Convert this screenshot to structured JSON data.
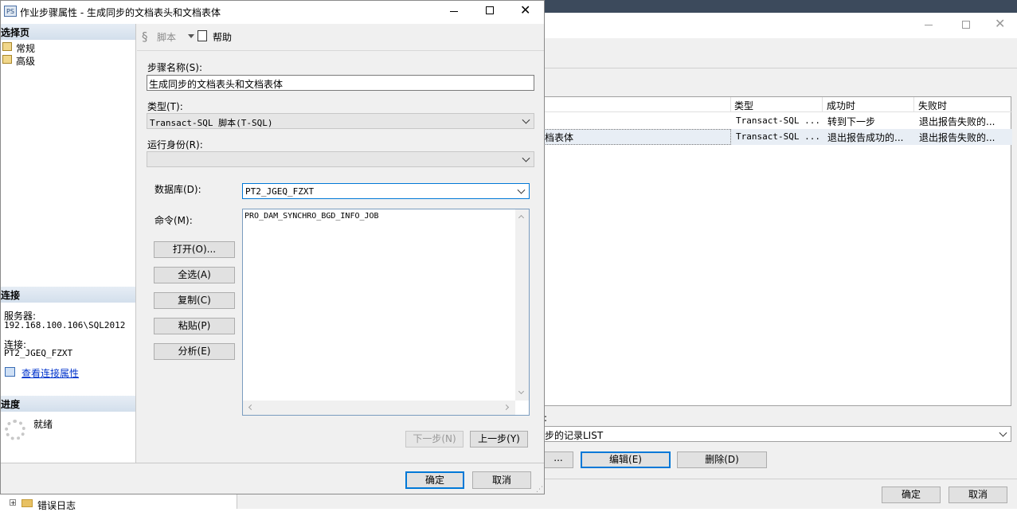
{
  "bg_window": {
    "grid_headers": [
      "类型",
      "成功时",
      "失败时"
    ],
    "rows": [
      {
        "step": "",
        "type": "Transact-SQL ...",
        "success": "转到下一步",
        "failure": "退出报告失败的..."
      },
      {
        "step": "档表体",
        "type": "Transact-SQL ...",
        "success": "退出报告成功的...",
        "failure": "退出报告失败的..."
      }
    ],
    "start_step_label": ":",
    "start_step_value": "步的记录LIST",
    "btn_new": "...",
    "btn_edit": "编辑(E)",
    "btn_delete": "删除(D)",
    "btn_ok": "确定",
    "btn_cancel": "取消",
    "bottom_tree_item": "错误日志"
  },
  "dialog": {
    "title": "作业步骤属性 - 生成同步的文档表头和文档表体",
    "sidebar": {
      "select_page_header": "选择页",
      "pages": [
        {
          "label": "常规"
        },
        {
          "label": "高级"
        }
      ],
      "connection_header": "连接",
      "server_label": "服务器:",
      "server_value": "192.168.100.106\\SQL2012",
      "connection_label": "连接:",
      "connection_value": "PT2_JGEQ_FZXT",
      "view_conn_props": "查看连接属性",
      "progress_header": "进度",
      "progress_status": "就绪"
    },
    "toolbar": {
      "script_label": "脚本",
      "help_label": "帮助"
    },
    "form": {
      "step_name_label": "步骤名称(S):",
      "step_name_value": "生成同步的文档表头和文档表体",
      "type_label": "类型(T):",
      "type_value": "Transact-SQL 脚本(T-SQL)",
      "run_as_label": "运行身份(R):",
      "run_as_value": "",
      "database_label": "数据库(D):",
      "database_value": "PT2_JGEQ_FZXT",
      "command_label": "命令(M):",
      "command_value": "PRO_DAM_SYNCHRO_BGD_INFO_JOB",
      "btn_open": "打开(O)...",
      "btn_select_all": "全选(A)",
      "btn_copy": "复制(C)",
      "btn_paste": "粘贴(P)",
      "btn_parse": "分析(E)",
      "btn_next": "下一步(N)",
      "btn_prev": "上一步(Y)"
    },
    "footer": {
      "ok": "确定",
      "cancel": "取消"
    }
  }
}
